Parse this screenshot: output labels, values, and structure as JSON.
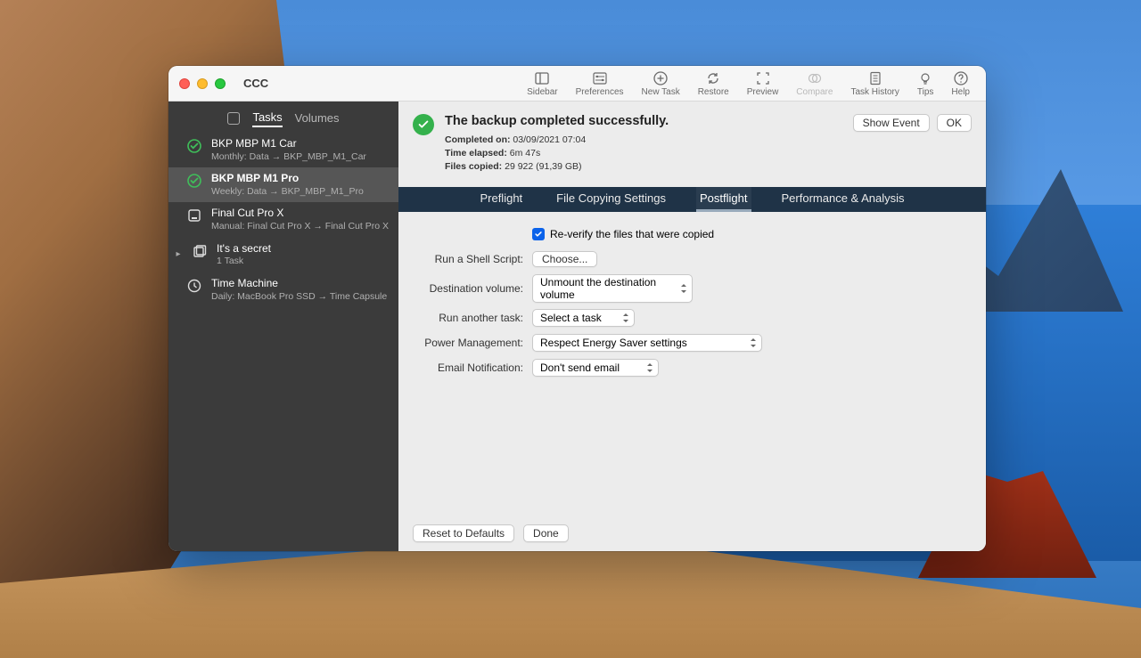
{
  "app": {
    "title": "CCC"
  },
  "toolbar": [
    {
      "key": "sidebar",
      "label": "Sidebar",
      "icon": "sidebar",
      "disabled": false
    },
    {
      "key": "preferences",
      "label": "Preferences",
      "icon": "sliders",
      "disabled": false
    },
    {
      "key": "newtask",
      "label": "New Task",
      "icon": "plus-circle",
      "disabled": false
    },
    {
      "key": "restore",
      "label": "Restore",
      "icon": "refresh",
      "disabled": false
    },
    {
      "key": "preview",
      "label": "Preview",
      "icon": "scan",
      "disabled": false
    },
    {
      "key": "compare",
      "label": "Compare",
      "icon": "compare",
      "disabled": true
    },
    {
      "key": "history",
      "label": "Task History",
      "icon": "doc",
      "disabled": false
    },
    {
      "key": "tips",
      "label": "Tips",
      "icon": "bulb",
      "disabled": false
    },
    {
      "key": "help",
      "label": "Help",
      "icon": "help",
      "disabled": false
    }
  ],
  "sidebarTabs": {
    "tasks": "Tasks",
    "volumes": "Volumes"
  },
  "tasks": [
    {
      "title": "BKP MBP M1 Car",
      "sub": "Monthly: Data → BKP_MBP_M1_Car",
      "icon": "ok",
      "sel": false
    },
    {
      "title": "BKP MBP M1 Pro",
      "sub": "Weekly: Data → BKP_MBP_M1_Pro",
      "icon": "ok",
      "sel": true
    },
    {
      "title": "Final Cut Pro X",
      "sub": "Manual: Final Cut Pro X → Final Cut Pro X",
      "icon": "disk",
      "sel": false
    },
    {
      "title": "It's a secret",
      "sub": "1 Task",
      "icon": "group",
      "sel": false,
      "chev": true
    },
    {
      "title": "Time Machine",
      "sub": "Daily: MacBook Pro SSD → Time Capsule",
      "icon": "clock",
      "sel": false
    }
  ],
  "status": {
    "title": "The backup completed successfully.",
    "lines": [
      {
        "label": "Completed on:",
        "value": "03/09/2021 07:04"
      },
      {
        "label": "Time elapsed:",
        "value": "6m 47s"
      },
      {
        "label": "Files copied:",
        "value": "29 922 (91,39 GB)"
      }
    ],
    "buttons": {
      "showEvent": "Show Event",
      "ok": "OK"
    }
  },
  "segments": [
    "Preflight",
    "File Copying Settings",
    "Postflight",
    "Performance & Analysis"
  ],
  "activeSegment": 2,
  "postflight": {
    "reverify": {
      "label": "Re-verify the files that were copied",
      "checked": true
    },
    "shellScript": {
      "label": "Run a Shell Script:",
      "button": "Choose..."
    },
    "destVolume": {
      "label": "Destination volume:",
      "value": "Unmount the destination volume"
    },
    "runAnother": {
      "label": "Run another task:",
      "value": "Select a task"
    },
    "power": {
      "label": "Power Management:",
      "value": "Respect Energy Saver settings"
    },
    "email": {
      "label": "Email Notification:",
      "value": "Don't send email"
    }
  },
  "footer": {
    "reset": "Reset to Defaults",
    "done": "Done"
  }
}
